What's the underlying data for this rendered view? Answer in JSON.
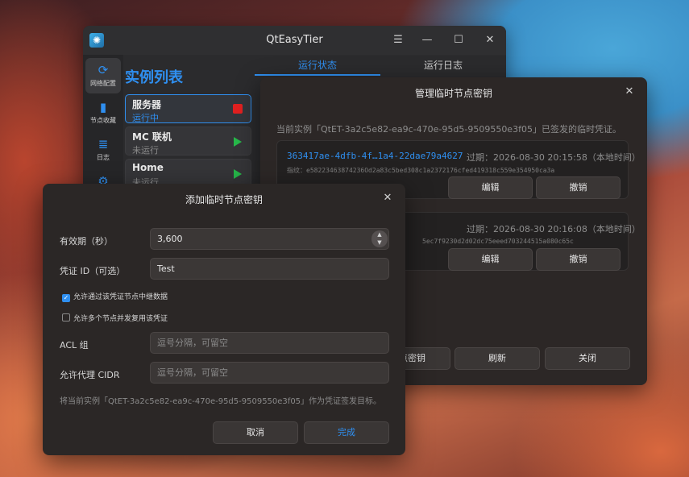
{
  "main_window": {
    "title": "QtEasyTier",
    "sidebar": [
      {
        "label": "网络配置",
        "icon": "network-icon"
      },
      {
        "label": "节点收藏",
        "icon": "bookmark-icon"
      },
      {
        "label": "日志",
        "icon": "log-icon"
      },
      {
        "label": "",
        "icon": "gear-icon"
      }
    ],
    "list_title": "实例列表",
    "instances": [
      {
        "name": "服务器",
        "status": "运行中"
      },
      {
        "name": "MC 联机",
        "status": "未运行"
      },
      {
        "name": "Home",
        "status": "未运行"
      }
    ],
    "tabs": [
      "运行状态",
      "运行日志"
    ]
  },
  "manage_dialog": {
    "title": "管理临时节点密钥",
    "description": "当前实例「QtET-3a2c5e82-ea9c-470e-95d5-9509550e3f05」已签发的临时凭证。",
    "keys": [
      {
        "id": "363417ae-4dfb-4f…1a4-22dae79a4627",
        "expires": "过期：2026-08-30 20:15:58（本地时间）",
        "fingerprint": "指纹：e58223463874236Od2a83c5bed308c1a2372176cfed419318c559e354950ca3a"
      },
      {
        "id": "",
        "expires": "过期：2026-08-30 20:16:08（本地时间）",
        "fingerprint": "5ec7f9230d2d02dc75eeed703244515a080c65c"
      }
    ],
    "edit_label": "编辑",
    "revoke_label": "撤销",
    "add_key_label": "节点密钥",
    "refresh_label": "刷新",
    "close_label": "关闭"
  },
  "add_dialog": {
    "title": "添加临时节点密钥",
    "validity_label": "有效期（秒）",
    "validity_value": "3,600",
    "credential_label": "凭证 ID（可选）",
    "credential_value": "Test",
    "allow_relay_label": "允许通过该凭证节点中继数据",
    "allow_relay_checked": true,
    "allow_multi_label": "允许多个节点并发复用该凭证",
    "allow_multi_checked": false,
    "acl_label": "ACL 组",
    "acl_placeholder": "逗号分隔，可留空",
    "cidr_label": "允许代理 CIDR",
    "cidr_placeholder": "逗号分隔，可留空",
    "footer_note": "将当前实例「QtET-3a2c5e82-ea9c-470e-95d5-9509550e3f05」作为凭证签发目标。",
    "cancel_label": "取消",
    "confirm_label": "完成"
  },
  "colors": {
    "accent": "#2f8ff0",
    "running_stop": "#e02020",
    "play": "#27b84a"
  }
}
